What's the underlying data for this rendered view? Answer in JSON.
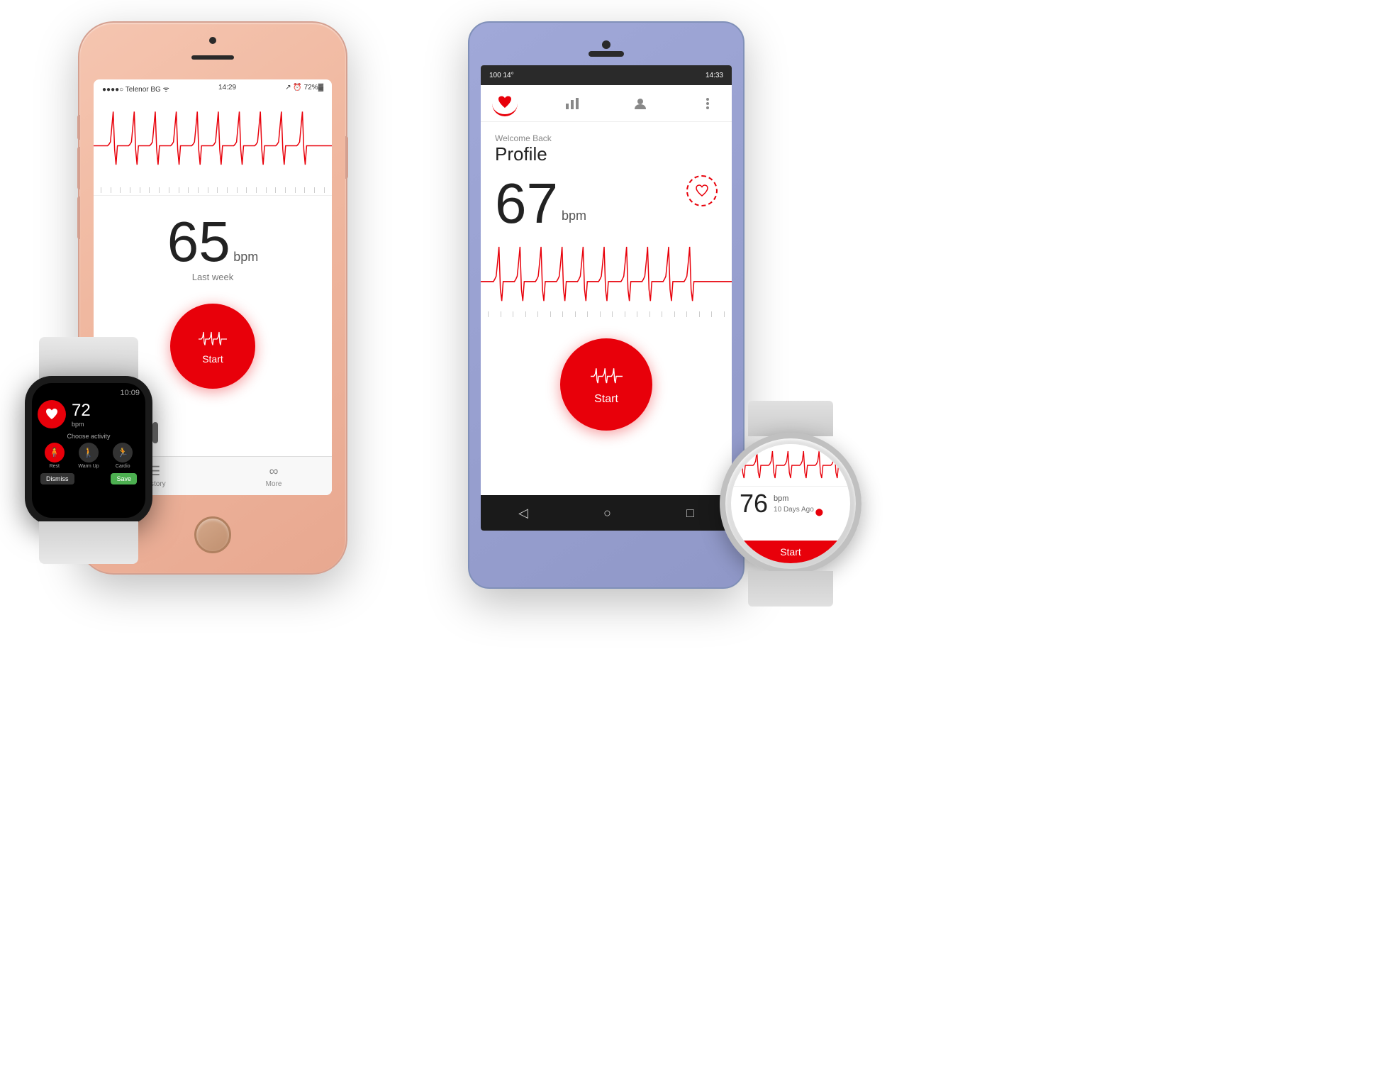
{
  "iphone": {
    "carrier": "●●●●○ Telenor BG ᯤ",
    "time": "14:29",
    "battery": "72%",
    "bpm": "65",
    "bpm_unit": "bpm",
    "bpm_label": "Last week",
    "start_label": "Start",
    "tabs": [
      {
        "label": "History",
        "icon": "☰"
      },
      {
        "label": "More",
        "icon": "∞"
      }
    ]
  },
  "apple_watch": {
    "time": "10:09",
    "bpm": "72",
    "bpm_unit": "bpm",
    "activity_label": "Choose activity",
    "activities": [
      {
        "label": "Rest",
        "icon": "🏃"
      },
      {
        "label": "Warm Up",
        "icon": "🚶"
      },
      {
        "label": "Cardio",
        "icon": "🏃"
      }
    ],
    "dismiss_label": "Dismiss",
    "save_label": "Save"
  },
  "android": {
    "status_left": "100  14°",
    "time": "14:33",
    "welcome_text": "Welcome Back",
    "profile_text": "Profile",
    "bpm": "67",
    "bpm_unit": "bpm",
    "start_label": "Start"
  },
  "gear_watch": {
    "bpm": "76",
    "bpm_unit": "bpm",
    "bpm_sublabel": "10 Days Ago",
    "start_label": "Start"
  }
}
